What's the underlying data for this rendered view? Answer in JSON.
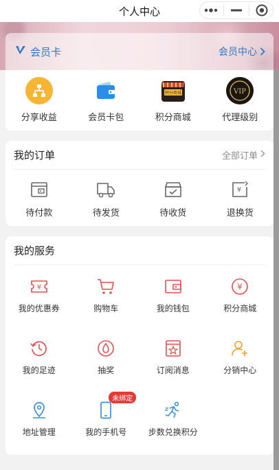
{
  "navbar": {
    "title": "个人中心"
  },
  "vip_card": {
    "label": "会员卡",
    "center_link": "会员中心"
  },
  "features": [
    {
      "label": "分享收益",
      "icon": "share-income-icon"
    },
    {
      "label": "会员卡包",
      "icon": "wallet-icon"
    },
    {
      "label": "积分商城",
      "icon": "points-mall-icon",
      "icon_text": "积分商城"
    },
    {
      "label": "代理级别",
      "icon": "vip-badge-icon",
      "icon_text": "VIP"
    }
  ],
  "orders": {
    "title": "我的订单",
    "all_link": "全部订单",
    "items": [
      {
        "label": "待付款",
        "icon": "pending-payment-icon"
      },
      {
        "label": "待发货",
        "icon": "truck-icon"
      },
      {
        "label": "待收货",
        "icon": "receive-box-icon"
      },
      {
        "label": "退换货",
        "icon": "refund-icon"
      }
    ]
  },
  "services": {
    "title": "我的服务",
    "items": [
      {
        "label": "我的优惠券",
        "icon": "coupon-icon"
      },
      {
        "label": "购物车",
        "icon": "cart-icon"
      },
      {
        "label": "我的钱包",
        "icon": "wallet-outline-icon"
      },
      {
        "label": "积分商城",
        "icon": "yen-circle-icon"
      },
      {
        "label": "我的足迹",
        "icon": "history-icon"
      },
      {
        "label": "抽奖",
        "icon": "lottery-drop-icon"
      },
      {
        "label": "订阅消息",
        "icon": "subscribe-star-icon"
      },
      {
        "label": "分销中心",
        "icon": "add-user-icon"
      },
      {
        "label": "地址管理",
        "icon": "location-pin-icon"
      },
      {
        "label": "我的手机号",
        "icon": "phone-icon",
        "badge": "未绑定"
      },
      {
        "label": "步数兑换积分",
        "icon": "running-icon"
      }
    ]
  },
  "colors": {
    "accent_blue": "#2a79c9",
    "service_red": "#e05050",
    "service_blue": "#3a8fd6",
    "service_orange": "#f0a030"
  }
}
